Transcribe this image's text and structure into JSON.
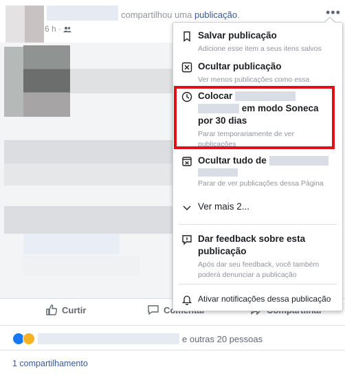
{
  "post": {
    "shared_text": "compartilhou uma",
    "shared_link": "publicação",
    "shared_suffix": ".",
    "time": "6 h ·",
    "more_icon": "more-dots-icon"
  },
  "menu": {
    "save": {
      "title": "Salvar publicação",
      "subtitle": "Adicione esse item a seus itens salvos",
      "icon": "bookmark-icon"
    },
    "hide": {
      "title": "Ocultar publicação",
      "subtitle": "Ver menos publicações como essa",
      "icon": "hide-box-icon"
    },
    "snooze": {
      "title_start": "Colocar",
      "title_end": "em modo Soneca",
      "title_line3": "por 30 dias",
      "subtitle_1": "Parar temporariamente de ver",
      "subtitle_2": "publicações",
      "icon": "clock-icon"
    },
    "hide_all": {
      "title": "Ocultar tudo de",
      "subtitle": "Parar de ver publicações dessa Página",
      "icon": "hide-all-icon"
    },
    "more": {
      "label": "Ver mais 2...",
      "icon": "chevron-down-icon"
    },
    "feedback": {
      "title_1": "Dar feedback sobre esta",
      "title_2": "publicação",
      "subtitle_1": "Após dar seu feedback, você também",
      "subtitle_2": "poderá denunciar a publicação",
      "icon": "feedback-icon"
    },
    "notify": {
      "label": "Ativar notificações dessa publicação",
      "icon": "bell-icon"
    }
  },
  "actions": {
    "like": "Curtir",
    "comment": "Comentar",
    "share": "Compartilhar"
  },
  "reactions": {
    "others": "e outras 20 pessoas"
  },
  "shares": "1 compartilhamento"
}
